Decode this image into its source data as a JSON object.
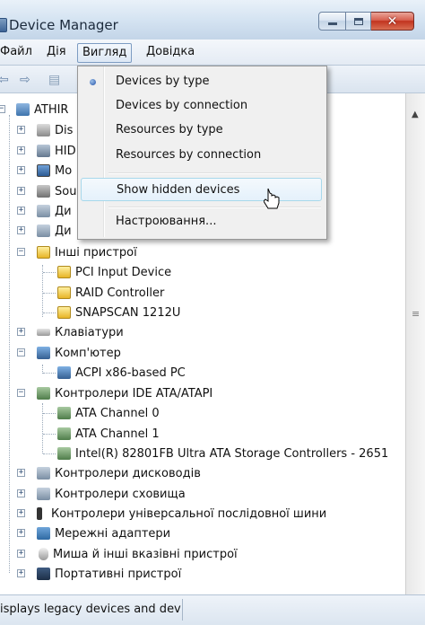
{
  "window": {
    "title": "Device Manager"
  },
  "menu": [
    "Файл",
    "Дія",
    "Вигляд",
    "Довідка"
  ],
  "view_menu": {
    "items": [
      {
        "label": "Devices by type",
        "checked": true
      },
      {
        "label": "Devices by connection"
      },
      {
        "label": "Resources by type"
      },
      {
        "label": "Resources by connection"
      },
      {
        "label": "Show hidden devices",
        "highlighted": true
      },
      {
        "label": "Настроювання..."
      }
    ]
  },
  "tree": [
    {
      "label": "ATHIR",
      "icon": "computer-icon"
    },
    {
      "label": "Dis",
      "icon": "disk-drive-icon"
    },
    {
      "label": "HID",
      "icon": "hid-icon"
    },
    {
      "label": "Mo",
      "icon": "monitor-icon"
    },
    {
      "label": "Sou",
      "icon": "sound-icon"
    },
    {
      "label": "Ди",
      "icon": "generic-device-icon"
    },
    {
      "label": "Ди",
      "icon": "generic-device-icon"
    },
    {
      "label": "Інші пристрої",
      "icon": "unknown-device-icon"
    },
    {
      "label": "PCI Input Device",
      "icon": "unknown-device-icon"
    },
    {
      "label": "RAID Controller",
      "icon": "unknown-device-icon"
    },
    {
      "label": "SNAPSCAN 1212U",
      "icon": "unknown-device-icon"
    },
    {
      "label": "Клавіатури",
      "icon": "keyboard-icon"
    },
    {
      "label": "Комп'ютер",
      "icon": "computer-icon"
    },
    {
      "label": "ACPI x86-based PC",
      "icon": "computer-icon"
    },
    {
      "label": "Контролери IDE ATA/ATAPI",
      "icon": "ide-controller-icon"
    },
    {
      "label": "ATA Channel 0",
      "icon": "ide-controller-icon"
    },
    {
      "label": "ATA Channel 1",
      "icon": "ide-controller-icon"
    },
    {
      "label": "Intel(R) 82801FB Ultra ATA Storage Controllers - 2651",
      "icon": "ide-controller-icon"
    },
    {
      "label": "Контролери дисководів",
      "icon": "floppy-controller-icon"
    },
    {
      "label": "Контролери сховища",
      "icon": "storage-controller-icon"
    },
    {
      "label": "Контролери універсальної послідовної шини",
      "icon": "usb-icon"
    },
    {
      "label": "Мережні адаптери",
      "icon": "network-adapter-icon"
    },
    {
      "label": "Миша й інші вказівні пристрої",
      "icon": "mouse-icon"
    },
    {
      "label": "Портативні пристрої",
      "icon": "portable-device-icon"
    }
  ],
  "status": {
    "text": "isplays legacy devices and dev"
  }
}
